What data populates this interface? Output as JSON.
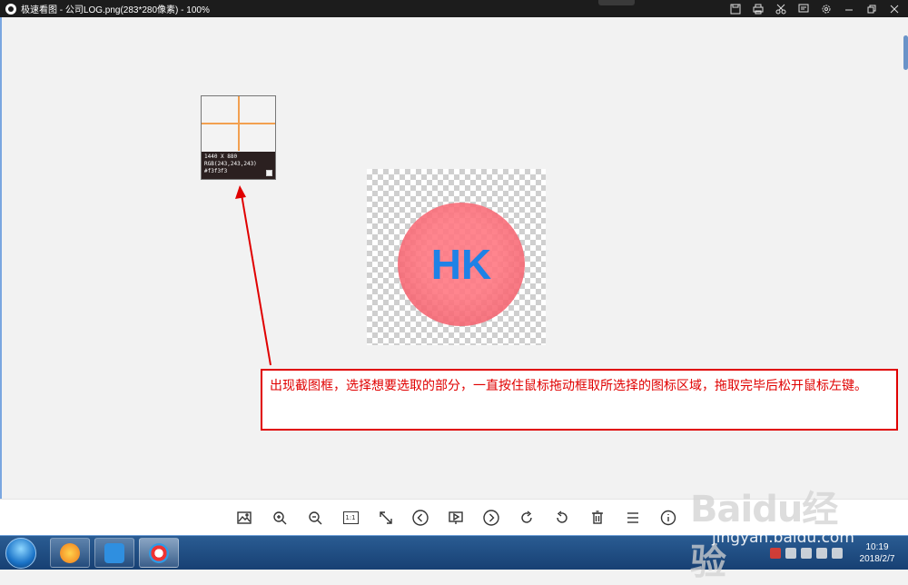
{
  "window": {
    "title": "极速看图 - 公司LOG.png(283*280像素) - 100%"
  },
  "magnifier": {
    "size": "1440 X 880",
    "rgb": "RGB(243,243,243)",
    "hex": "#f3f3f3"
  },
  "image": {
    "logo_text": "HK"
  },
  "annotation": {
    "text": "出现截图框，选择想要选取的部分，一直按住鼠标拖动框取所选择的图标区域，拖取完毕后松开鼠标左键。"
  },
  "toolbar": {
    "items": [
      "open-image",
      "zoom-in",
      "zoom-out",
      "actual-size",
      "fit-window",
      "previous",
      "slideshow",
      "next",
      "rotate-right",
      "rotate-left",
      "delete",
      "menu",
      "info"
    ],
    "actual_size_label": "1:1"
  },
  "taskbar": {
    "clock_time": "10:19",
    "clock_date": "2018/2/7"
  },
  "watermark": {
    "brand": "Baidu经验",
    "site": "jingyan.baidu.com"
  },
  "colors": {
    "annotation": "#e00000",
    "logo_text": "#1e82e6",
    "logo_circle": "#f06070"
  }
}
